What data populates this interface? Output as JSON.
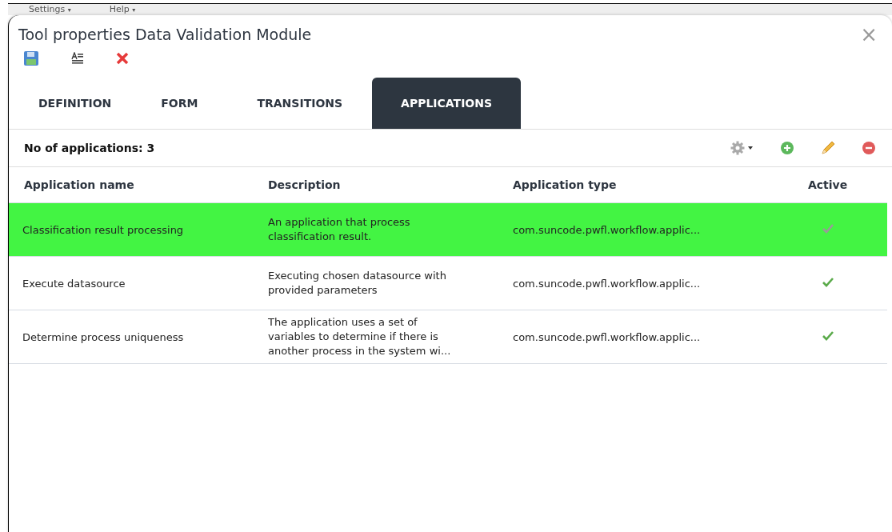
{
  "menu": [
    {
      "label": "Settings",
      "caret": "▾"
    },
    {
      "label": "Help",
      "caret": "▾"
    }
  ],
  "window": {
    "title": "Tool properties Data Validation Module",
    "close": "×"
  },
  "tabs": [
    {
      "label": "DEFINITION",
      "selected": false
    },
    {
      "label": "FORM",
      "selected": false
    },
    {
      "label": "TRANSITIONS",
      "selected": false
    },
    {
      "label": "APPLICATIONS",
      "selected": true
    }
  ],
  "count_label": "No of applications: 3",
  "table": {
    "columns": [
      "Application name",
      "Description",
      "Application type",
      "Active"
    ],
    "rows": [
      {
        "name": "Classification result processing",
        "description": "An application that process classification result.",
        "type": "com.suncode.pwfl.workflow.applic...",
        "active": true,
        "selected": true
      },
      {
        "name": "Execute datasource",
        "description": "Executing chosen datasource with provided parameters",
        "type": "com.suncode.pwfl.workflow.applic...",
        "active": true,
        "selected": false
      },
      {
        "name": "Determine process uniqueness",
        "description": "The application uses a set of variables to determine if there is another process in the system wi...",
        "type": "com.suncode.pwfl.workflow.applic...",
        "active": true,
        "selected": false
      }
    ]
  }
}
